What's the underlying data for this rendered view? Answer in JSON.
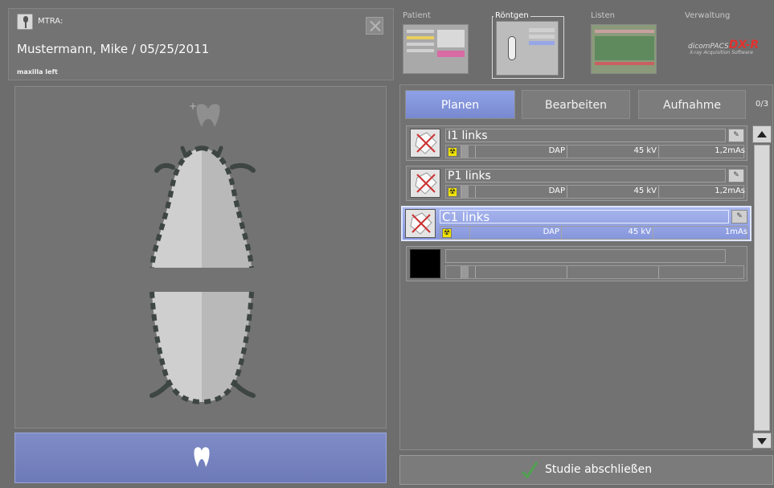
{
  "header": {
    "user_label": "MTRA:",
    "patient": "Mustermann, Mike / 05/25/2011",
    "region": "maxilla left"
  },
  "nav": {
    "patient": "Patient",
    "roentgen": "Röntgen",
    "listen": "Listen",
    "verwaltung": "Verwaltung"
  },
  "brand": {
    "prefix": "dicomPACS",
    "name": "DX-R",
    "tagline": "X-ray Acquisition Software"
  },
  "tabs": {
    "planen": "Planen",
    "bearbeiten": "Bearbeiten",
    "aufnahme": "Aufnahme",
    "counter": "0/3"
  },
  "exposures": [
    {
      "label": "I1 links",
      "dap": "DAP",
      "kv": "45 kV",
      "mas": "1,2mAs"
    },
    {
      "label": "P1 links",
      "dap": "DAP",
      "kv": "45 kV",
      "mas": "1,2mAs"
    },
    {
      "label": "C1 links",
      "dap": "DAP",
      "kv": "45 kV",
      "mas": "1mAs"
    }
  ],
  "footer": {
    "finish": "Studie abschließen"
  },
  "colors": {
    "accent": "#8696dc",
    "background": "#6d6d6d",
    "radiation": "#f2e400",
    "brand": "#e0322f"
  }
}
